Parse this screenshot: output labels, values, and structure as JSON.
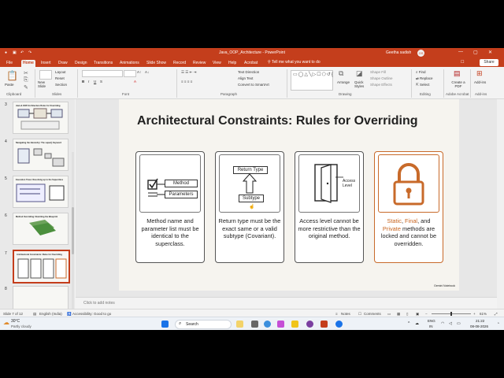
{
  "window": {
    "title": "Java_OOP_Architecture  -  PowerPoint",
    "user_name": "Geetha sadish",
    "user_initials": "GS"
  },
  "ribbon_tabs": [
    "File",
    "Home",
    "Insert",
    "Draw",
    "Design",
    "Transitions",
    "Animations",
    "Slide Show",
    "Record",
    "Review",
    "View",
    "Help",
    "Acrobat"
  ],
  "active_tab": "Home",
  "tell_me": "Tell me what you want to do",
  "share_label": "Share",
  "comments_label": "",
  "ribbon": {
    "paste": "Paste",
    "new_slide": "New Slide",
    "layout": "Layout",
    "reset": "Reset",
    "section": "Section",
    "text_direction": "Text Direction",
    "align_text": "Align Text",
    "convert_smartart": "Convert to SmartArt",
    "arrange": "Arrange",
    "quick_styles": "Quick Styles",
    "shape_fill": "Shape Fill",
    "shape_outline": "Shape Outline",
    "shape_effects": "Shape Effects",
    "find": "Find",
    "replace": "Replace",
    "select": "Select",
    "create_pdf": "Create a PDF",
    "add_ins": "Add-ins",
    "groups": [
      "Clipboard",
      "Slides",
      "Font",
      "Paragraph",
      "Drawing",
      "Editing",
      "Adobe Acrobat",
      "Add-ins"
    ]
  },
  "thumbnails": [
    {
      "num": "3",
      "title": "Java & OOP Architecture Rules for Overriding"
    },
    {
      "num": "4",
      "title": "Navigating the Hierarchy: The super() Keyword"
    },
    {
      "num": "5",
      "title": "Execution Trace: Resolving up to the Superclass"
    },
    {
      "num": "6",
      "title": "Method Overriding: Rewriting the Blueprint"
    },
    {
      "num": "7",
      "title": "Architectural Constraints: Rules for Overriding"
    },
    {
      "num": "8",
      "title": ""
    }
  ],
  "selected_thumbnail": "7",
  "slide": {
    "title": "Architectural Constraints: Rules for Overriding",
    "card1": {
      "box1": "Method",
      "box2": "Parameters",
      "text": "Method name and parameter list must be identical to the superclass."
    },
    "card2": {
      "top": "Return Type",
      "bottom": "Subtype",
      "text": "Return type must be the exact same or a valid subtype (Covariant)."
    },
    "card3": {
      "label_line1": "Access",
      "label_line2": "Level",
      "text": "Access level cannot be more restrictive than the original method."
    },
    "card4": {
      "kw1": "Static",
      "kw2": "Final",
      "kw3": "Private",
      "sep1": ", ",
      "sep2": ", and ",
      "text": " methods are locked and cannot be overridden."
    },
    "watermark": "Gemini Notebook"
  },
  "notes_placeholder": "Click to add notes",
  "status": {
    "slide_of": "Slide 7 of 12",
    "language": "English (India)",
    "accessibility": "Accessibility: Good to go",
    "notes": "Notes",
    "comments": "Comments",
    "zoom": "61%"
  },
  "taskbar": {
    "weather_temp": "30°C",
    "weather_desc": "Partly cloudy",
    "search": "Search",
    "lang1": "ENG",
    "lang2": "IN",
    "time": "21:22",
    "date": "08-08-2026"
  },
  "colors": {
    "accent": "#c43e1c",
    "orange": "#c8651f"
  }
}
